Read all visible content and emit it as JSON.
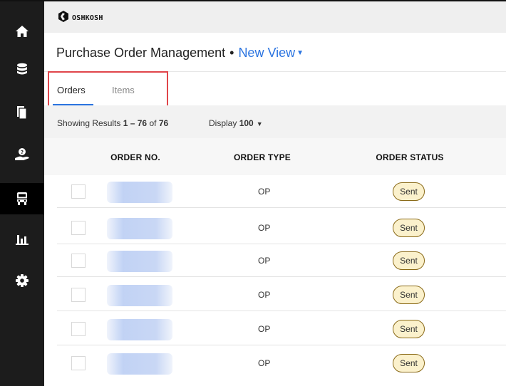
{
  "app": {
    "brand": "OSHKOSH",
    "title": "Purchase Order Management",
    "separator": "•",
    "view_label": "New View"
  },
  "sidebar": {
    "items": [
      {
        "icon": "home-icon",
        "active": false
      },
      {
        "icon": "database-icon",
        "active": false
      },
      {
        "icon": "documents-icon",
        "active": false
      },
      {
        "icon": "hand-help-icon",
        "active": false
      },
      {
        "icon": "truck-icon",
        "active": true
      },
      {
        "icon": "bar-chart-icon",
        "active": false
      },
      {
        "icon": "gear-icon",
        "active": false
      }
    ]
  },
  "tabs": [
    {
      "label": "Orders",
      "active": true
    },
    {
      "label": "Items",
      "active": false
    }
  ],
  "results": {
    "prefix": "Showing Results",
    "range": "1 – 76",
    "of": "of",
    "total": "76"
  },
  "display": {
    "label": "Display",
    "value": "100"
  },
  "table": {
    "headers": [
      "ORDER NO.",
      "ORDER TYPE",
      "ORDER STATUS"
    ],
    "rows": [
      {
        "order_type": "OP",
        "status": "Sent"
      },
      {
        "order_type": "OP",
        "status": "Sent"
      },
      {
        "order_type": "OP",
        "status": "Sent"
      },
      {
        "order_type": "OP",
        "status": "Sent"
      },
      {
        "order_type": "OP",
        "status": "Sent"
      },
      {
        "order_type": "OP",
        "status": "Sent"
      }
    ]
  },
  "colors": {
    "accent": "#2b74e0",
    "sidebar": "#1c1c1c",
    "highlight": "#e0454a",
    "badge_bg": "#fbf1cc",
    "badge_border": "#8a6a18"
  }
}
